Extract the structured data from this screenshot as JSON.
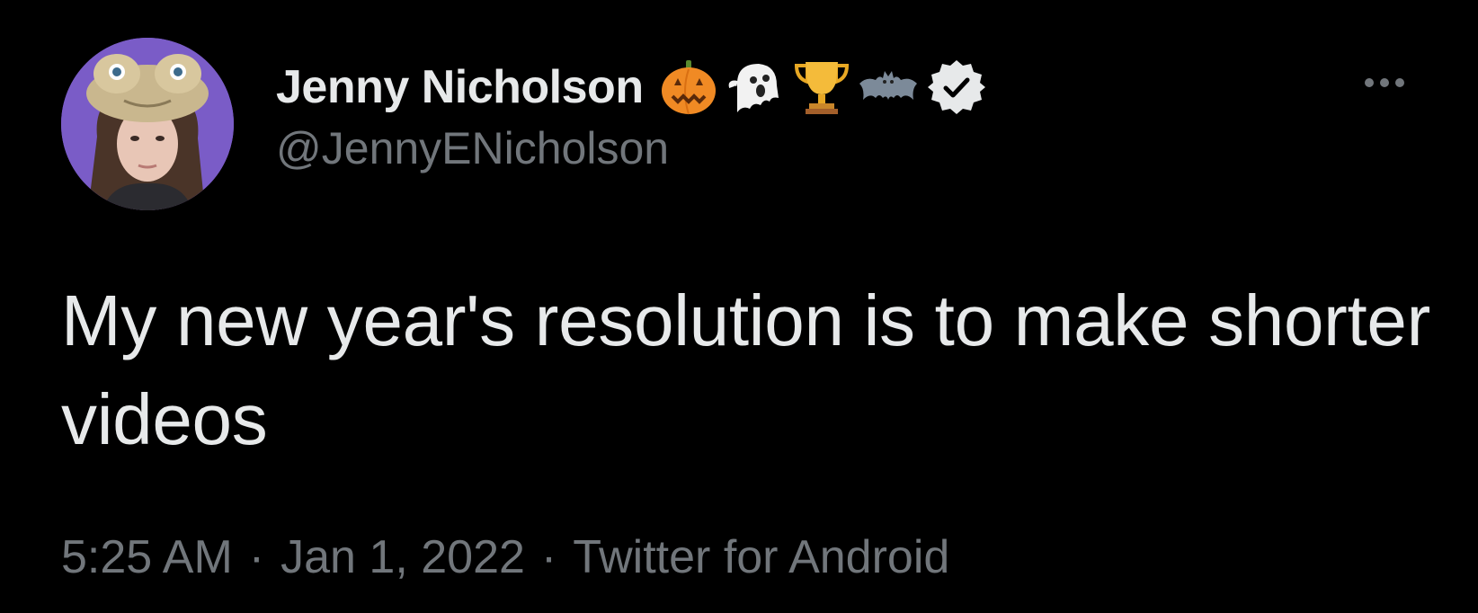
{
  "author": {
    "display_name": "Jenny Nicholson",
    "handle": "@JennyENicholson",
    "name_emojis": [
      "jack-o-lantern-icon",
      "ghost-icon",
      "trophy-icon",
      "bat-icon"
    ],
    "verified": true,
    "avatar_bg": "#7a5cc7"
  },
  "tweet": {
    "text": "My new year's resolution is to make shorter videos",
    "time": "5:25 AM",
    "separator": "·",
    "date": "Jan 1, 2022",
    "source": "Twitter for Android"
  },
  "colors": {
    "background": "#000000",
    "primary_text": "#e7e9ea",
    "secondary_text": "#71767b"
  }
}
